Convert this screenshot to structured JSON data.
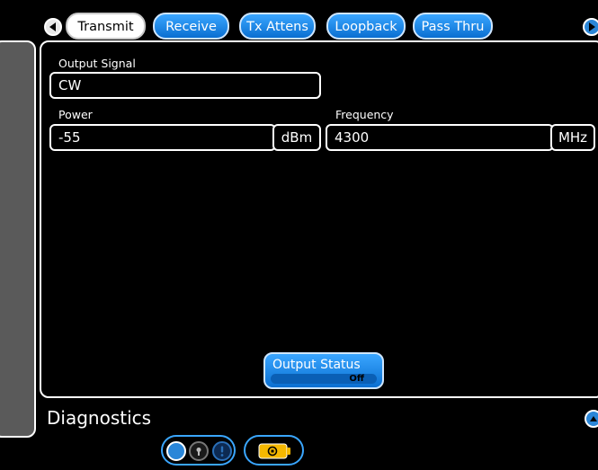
{
  "tabs": [
    {
      "label": "Transmit",
      "active": true
    },
    {
      "label": "Receive",
      "active": false
    },
    {
      "label": "Tx Attens",
      "active": false
    },
    {
      "label": "Loopback",
      "active": false
    },
    {
      "label": "Pass Thru",
      "active": false
    }
  ],
  "output_signal": {
    "label": "Output Signal",
    "value": "CW"
  },
  "power": {
    "label": "Power",
    "value": "-55",
    "unit": "dBm"
  },
  "frequency": {
    "label": "Frequency",
    "value": "4300",
    "unit": "MHz"
  },
  "output_status": {
    "label": "Output Status",
    "value": "Off"
  },
  "diagnostics": {
    "title": "Diagnostics"
  },
  "colors": {
    "accent": "#2a86d8",
    "background": "#000000",
    "border": "#ffffff",
    "battery": "#f5b800"
  },
  "icons": [
    "nav-left-arrow-icon",
    "nav-right-arrow-icon",
    "collapse-up-icon",
    "lock-icon",
    "alert-icon",
    "battery-icon"
  ]
}
